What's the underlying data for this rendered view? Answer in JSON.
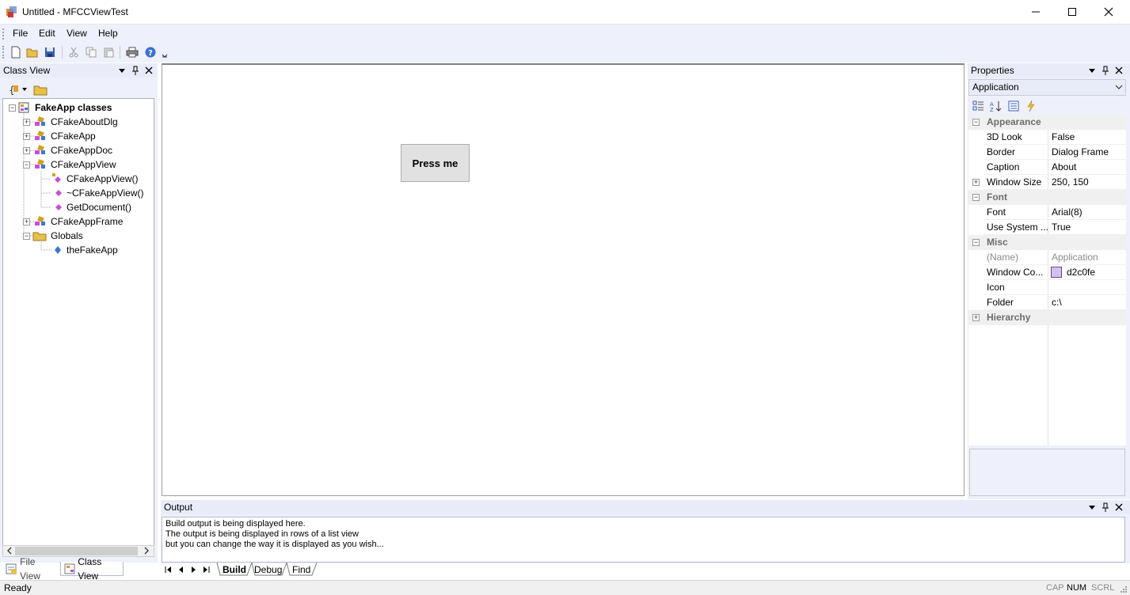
{
  "window": {
    "title": "Untitled - MFCCViewTest",
    "minimize": "─",
    "maximize": "☐",
    "close": "✕"
  },
  "menu": [
    "File",
    "Edit",
    "View",
    "Help"
  ],
  "class_view": {
    "title": "Class View",
    "tree": [
      {
        "label": "FakeApp classes",
        "bold": true
      },
      {
        "label": "CFakeAboutDlg"
      },
      {
        "label": "CFakeApp"
      },
      {
        "label": "CFakeAppDoc"
      },
      {
        "label": "CFakeAppView"
      },
      {
        "label": "CFakeAppView()"
      },
      {
        "label": "~CFakeAppView()"
      },
      {
        "label": "GetDocument()"
      },
      {
        "label": "CFakeAppFrame"
      },
      {
        "label": "Globals"
      },
      {
        "label": "theFakeApp"
      }
    ],
    "tabs": [
      "File View",
      "Class View"
    ]
  },
  "main": {
    "button_label": "Press me"
  },
  "properties": {
    "title": "Properties",
    "object": "Application",
    "categories": {
      "appearance": "Appearance",
      "font": "Font",
      "misc": "Misc",
      "hierarchy": "Hierarchy"
    },
    "rows": {
      "look3d": {
        "name": "3D Look",
        "value": "False"
      },
      "border": {
        "name": "Border",
        "value": "Dialog Frame"
      },
      "caption": {
        "name": "Caption",
        "value": "About"
      },
      "winsize": {
        "name": "Window Size",
        "value": "250, 150"
      },
      "font": {
        "name": "Font",
        "value": "Arial(8)"
      },
      "usesys": {
        "name": "Use System ...",
        "value": "True"
      },
      "name": {
        "name": "(Name)",
        "value": "Application"
      },
      "wincolor": {
        "name": "Window Co...",
        "value": "d2c0fe",
        "swatch": "#d2c0fe"
      },
      "icon": {
        "name": "Icon",
        "value": ""
      },
      "folder": {
        "name": "Folder",
        "value": "c:\\"
      }
    }
  },
  "output": {
    "title": "Output",
    "lines": [
      "Build output is being displayed here.",
      "The output is being displayed in rows of a list view",
      "but you can change the way it is displayed as you wish..."
    ],
    "tabs": [
      "Build",
      "Debug",
      "Find"
    ]
  },
  "status": {
    "text": "Ready",
    "indicators": [
      "CAP",
      "NUM",
      "SCRL"
    ]
  },
  "colors": {
    "panel_bg": "#eef0fb",
    "header_bg": "#e9ecf8",
    "method_icon": "#c850d8",
    "class_icon": "#d4a020",
    "global_icon": "#3a78d8"
  }
}
